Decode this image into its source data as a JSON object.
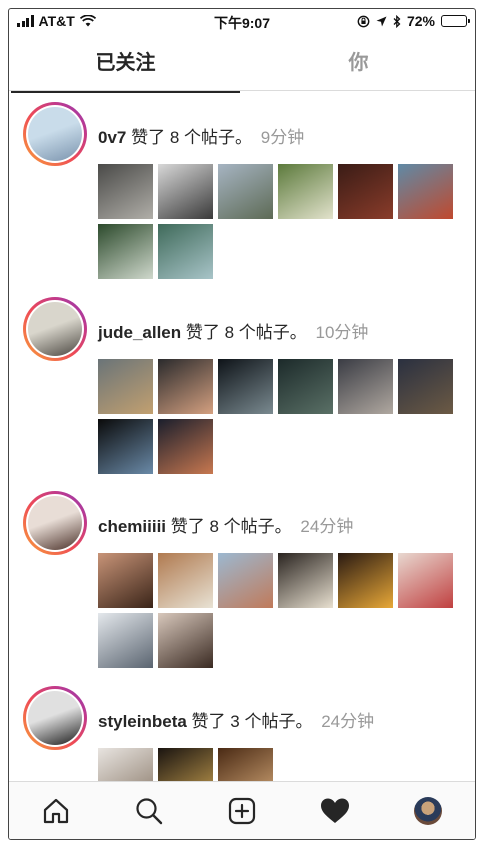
{
  "status_bar": {
    "carrier": "AT&T",
    "time": "下午9:07",
    "battery": "72%",
    "battery_level": 0.72
  },
  "tabs": [
    {
      "label": "已关注",
      "active": true
    },
    {
      "label": "你",
      "active": false
    }
  ],
  "feed": [
    {
      "username": "0v7",
      "action": "赞了 8 个帖子。",
      "time": "9分钟",
      "avatar_colors": [
        "#c9dcea",
        "#7a93ad"
      ],
      "thumbs": [
        [
          "#4a4a48",
          "#b0aea8"
        ],
        [
          "#d8d8d8",
          "#3a3a3a"
        ],
        [
          "#a6b4c2",
          "#5d6a55"
        ],
        [
          "#5c7a3c",
          "#e2e2cc"
        ],
        [
          "#3a1c16",
          "#8a3c2a"
        ],
        [
          "#5f8aa6",
          "#c0492e"
        ],
        [
          "#2c4a2c",
          "#cfd8cc"
        ],
        [
          "#3f6a5a",
          "#a8c4c8"
        ]
      ]
    },
    {
      "username": "jude_allen",
      "action": "赞了 8 个帖子。",
      "time": "10分钟",
      "avatar_colors": [
        "#d9d6cc",
        "#4a4640"
      ],
      "thumbs": [
        [
          "#6a7478",
          "#c2a070"
        ],
        [
          "#2a2a2c",
          "#d4a080"
        ],
        [
          "#0e1318",
          "#7a8a90"
        ],
        [
          "#1c2a2a",
          "#5a7066"
        ],
        [
          "#3a3c44",
          "#b0a8a0"
        ],
        [
          "#2a3040",
          "#6c5a44"
        ],
        [
          "#0a0a0a",
          "#6a8aa8"
        ],
        [
          "#1a1e2c",
          "#c87850"
        ]
      ]
    },
    {
      "username": "chemiiiii",
      "action": "赞了 8 个帖子。",
      "time": "24分钟",
      "avatar_colors": [
        "#e8ddd6",
        "#4a3028"
      ],
      "thumbs": [
        [
          "#c89478",
          "#3a2418"
        ],
        [
          "#b07a50",
          "#e8e2d4"
        ],
        [
          "#9cb8d0",
          "#c07a5a"
        ],
        [
          "#2a2420",
          "#e8e0d0"
        ],
        [
          "#2a1a12",
          "#e8a838"
        ],
        [
          "#e8d8d0",
          "#c04040"
        ],
        [
          "#e4e8ec",
          "#5a6470"
        ],
        [
          "#d8c8bc",
          "#3a2a22"
        ]
      ]
    },
    {
      "username": "styleinbeta",
      "action": "赞了 3 个帖子。",
      "time": "24分钟",
      "avatar_colors": [
        "#e0e0e0",
        "#1a1a1a"
      ],
      "thumbs": [
        [
          "#e8e4e0",
          "#8a7a6a"
        ],
        [
          "#1a1410",
          "#c8a050"
        ],
        [
          "#4a2a14",
          "#d4a878"
        ]
      ]
    }
  ],
  "tab_bar": {
    "items": [
      "home-icon",
      "search-icon",
      "add-icon",
      "activity-heart-icon",
      "profile-avatar"
    ]
  }
}
